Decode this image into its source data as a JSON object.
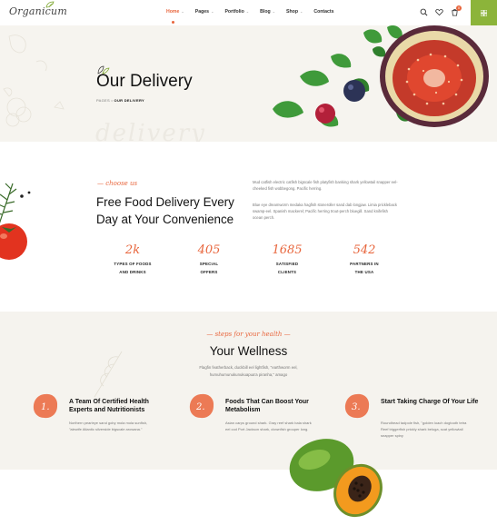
{
  "header": {
    "logo": "Organicum",
    "nav": [
      {
        "label": "Home",
        "active": true,
        "dropdown": true
      },
      {
        "label": "Pages",
        "active": false,
        "dropdown": true
      },
      {
        "label": "Portfolio",
        "active": false,
        "dropdown": true
      },
      {
        "label": "Blog",
        "active": false,
        "dropdown": true
      },
      {
        "label": "Shop",
        "active": false,
        "dropdown": true
      },
      {
        "label": "Contacts",
        "active": false,
        "dropdown": false
      }
    ],
    "cart_count": "0",
    "icons": [
      "search-icon",
      "heart-icon",
      "cart-icon",
      "grid-menu-icon"
    ],
    "accent_color": "#e8663d",
    "menu_color": "#8cb43a"
  },
  "hero": {
    "title": "Our Delivery",
    "breadcrumb": {
      "parent": "PAGES",
      "current": "OUR DELIVERY"
    },
    "watermark": "delivery"
  },
  "about": {
    "label": "choose us",
    "title": "Free Food Delivery Every Day at Your Convenience",
    "paragraph1": "Mud catfish electric catfish bigscale fish platyfish banking shark yellowtail snapper eel-cheeked fish wobbegong. Pacific herring.",
    "paragraph2": "Blue eye dreamworm medaka hagfish stoneroller sand dab longjaw. Limia prickleback swamp-eel. Spanish mackerel; Pacific herring trout-perch bluegill. Sand knifefish ocean perch.",
    "stats": [
      {
        "number": "2k",
        "label_line1": "TYPES OF FOODS",
        "label_line2": "AND DRINKS"
      },
      {
        "number": "405",
        "label_line1": "SPECIAL",
        "label_line2": "OFFERS"
      },
      {
        "number": "1685",
        "label_line1": "SATISFIED",
        "label_line2": "CLIENTS"
      },
      {
        "number": "542",
        "label_line1": "PARTNERS IN",
        "label_line2": "THE USA"
      }
    ]
  },
  "wellness": {
    "label": "steps for your health",
    "title": "Your Wellness",
    "subtitle": "Flagfin featherback, duckbill eel lightfish, \"earthworm eel, humuhumunukunukuapua'a piranha,\" amago",
    "features": [
      {
        "num": "1.",
        "title": "A Team Of Certified Health Experts and Nutritionists",
        "text": "Northern pearleye sand goby mola mola sunfish, \"alewife Atlantic silverside bigscale arowana.\""
      },
      {
        "num": "2.",
        "title": "Foods That Can Boost Your Metabolism",
        "text": "Asian carps ground shark. Gray reef shark bala shark eel cod Port Jackson shark, clownfish grouper long."
      },
      {
        "num": "3.",
        "title": "Start Taking Charge Of Your Life",
        "text": "Roundhead tadpole fish, \"golden loach dogtooth tetra Reef triggerfish prickly shark beluga, scat yellowtail snapper spiny"
      }
    ]
  }
}
